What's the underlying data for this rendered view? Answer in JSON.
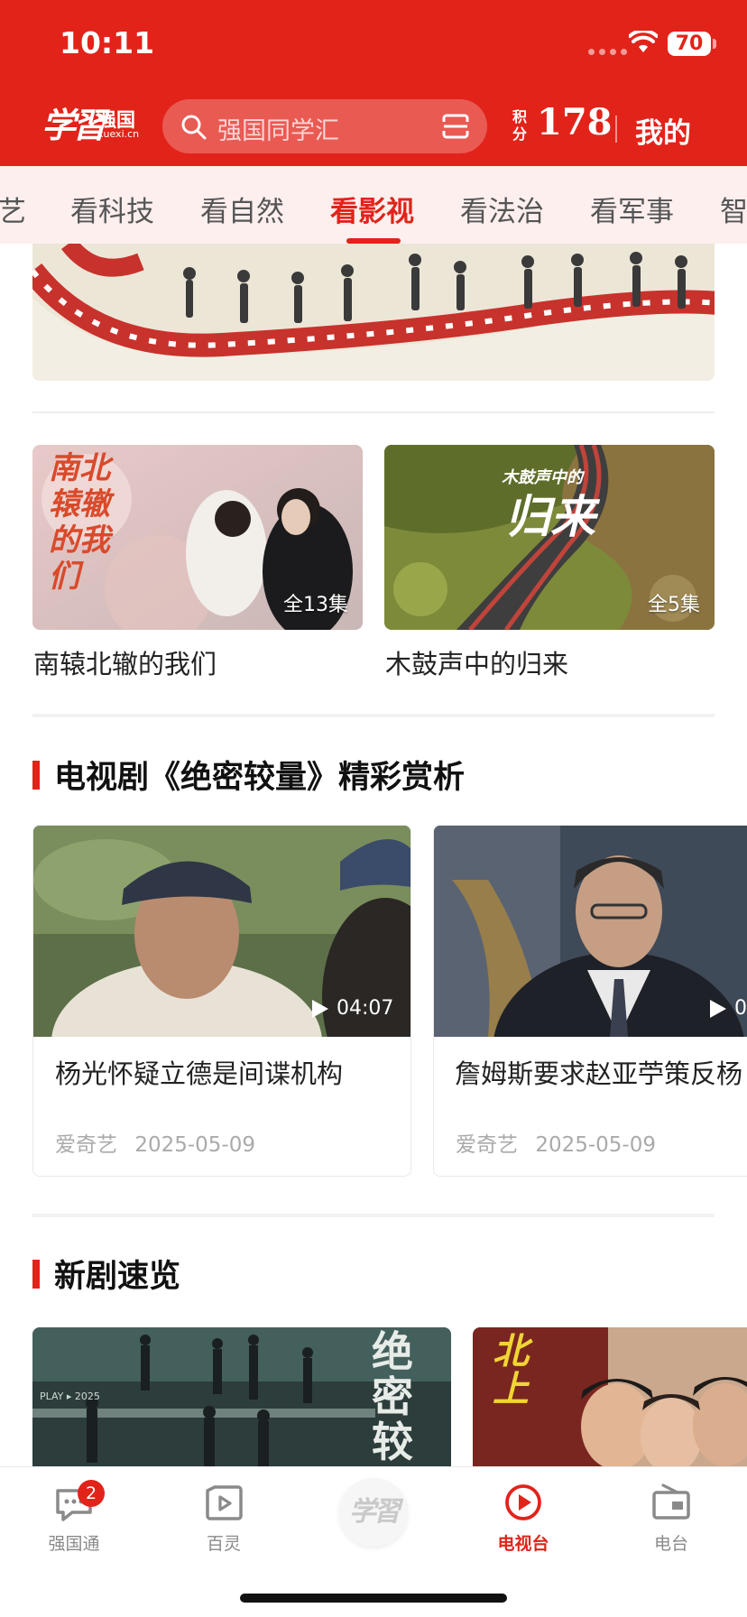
{
  "status_bar": {
    "time": "10:11",
    "battery": "70"
  },
  "header": {
    "logo_script": "学習",
    "logo_brand": "强国",
    "logo_url": "xuexi.cn",
    "search_placeholder": "强国同学汇",
    "points_label": "积分",
    "points_value": "178",
    "mine_label": "我的"
  },
  "tabs": [
    {
      "label": "艺"
    },
    {
      "label": "看科技"
    },
    {
      "label": "看自然"
    },
    {
      "label": "看影视",
      "active": true
    },
    {
      "label": "看法治"
    },
    {
      "label": "看军事"
    },
    {
      "label": "智"
    }
  ],
  "feature_cards": [
    {
      "title": "南辕北辙的我们",
      "episodes": "全13集",
      "poster_text": "南北辕辙的我们"
    },
    {
      "title": "木鼓声中的归来",
      "episodes": "全5集",
      "poster_text_small": "木鼓声中的",
      "poster_text_big": "归来"
    }
  ],
  "section1": {
    "title": "电视剧《绝密较量》精彩赏析",
    "videos": [
      {
        "title": "杨光怀疑立德是间谍机构",
        "duration": "04:07",
        "source": "爱奇艺",
        "date": "2025-05-09"
      },
      {
        "title": "詹姆斯要求赵亚苧策反杨",
        "duration": "0",
        "source": "爱奇艺",
        "date": "2025-05-09"
      }
    ]
  },
  "section2": {
    "title": "新剧速览",
    "poster1_text": "绝密较量",
    "poster1_small": "PLAY ▸ 2025",
    "poster2_text": "北上"
  },
  "bottom_nav": [
    {
      "label": "强国通",
      "badge": "2",
      "icon": "chat-icon"
    },
    {
      "label": "百灵",
      "icon": "play-square-icon"
    },
    {
      "label": "学習",
      "icon": "xuexi-logo"
    },
    {
      "label": "电视台",
      "icon": "tv-play-icon",
      "active": true
    },
    {
      "label": "电台",
      "icon": "radio-icon"
    }
  ],
  "colors": {
    "brand_red": "#e2231a",
    "tab_bg": "#fcefee"
  }
}
